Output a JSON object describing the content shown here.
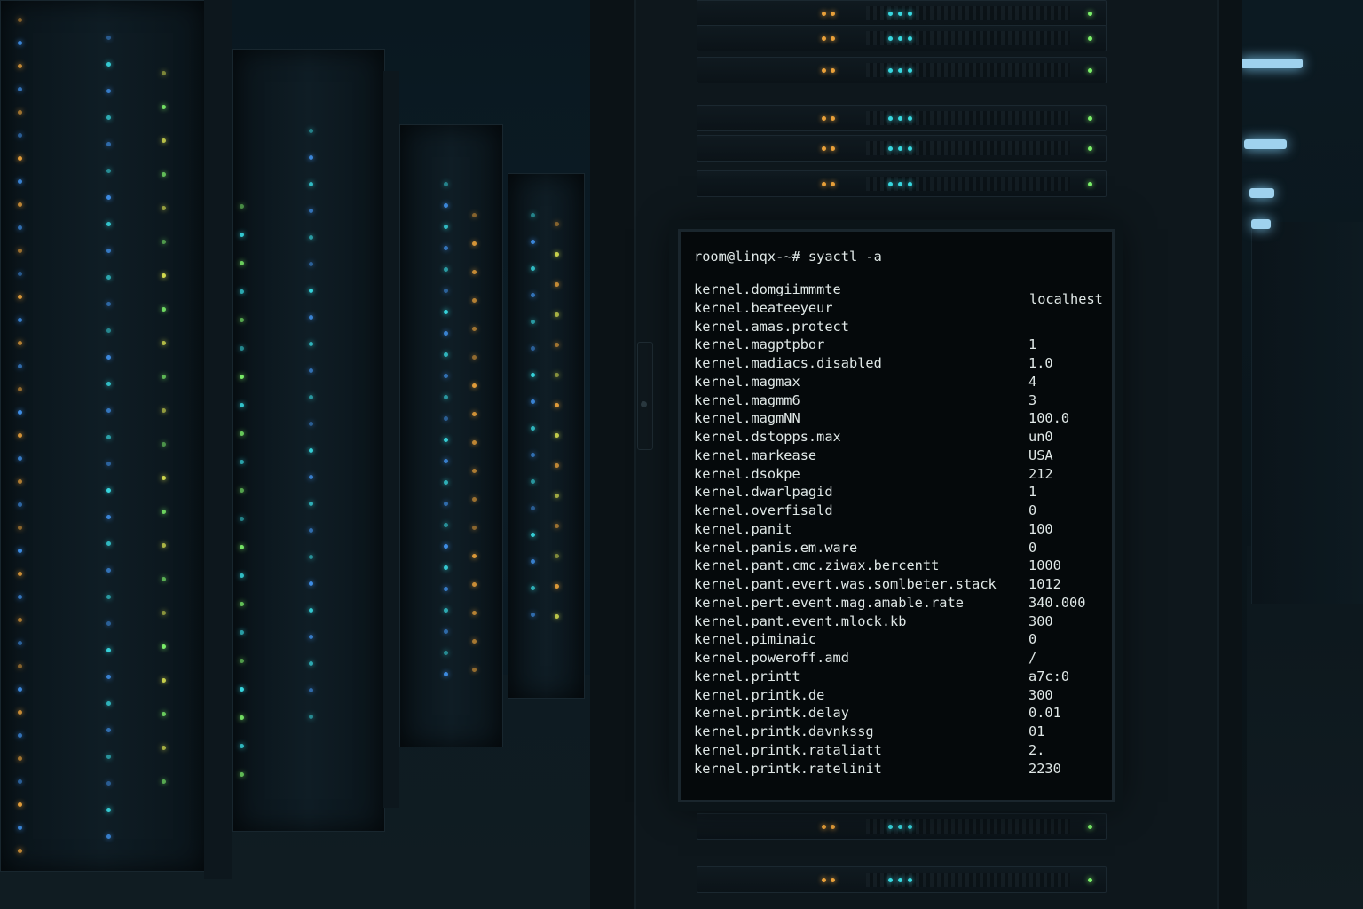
{
  "terminal": {
    "prompt": "room@linqx-~# syactl -a",
    "host": "localhest",
    "rows": [
      {
        "key": "kernel.domgiimmmte",
        "value": ""
      },
      {
        "key": "kernel.beateeyeur",
        "value": ""
      },
      {
        "key": "kernel.amas.protect",
        "value": ""
      },
      {
        "key": "kernel.magptpbor",
        "value": "1"
      },
      {
        "key": "kernel.madiacs.disabled",
        "value": "1.0"
      },
      {
        "key": "kernel.magmax",
        "value": "4"
      },
      {
        "key": "kernel.magmm6",
        "value": "3"
      },
      {
        "key": "kernel.magmNN",
        "value": "100.0"
      },
      {
        "key": "kernel.dstopps.max",
        "value": "un0"
      },
      {
        "key": "kernel.markease",
        "value": "USA"
      },
      {
        "key": "kernel.dsokpe",
        "value": "212"
      },
      {
        "key": "kernel.dwarlpagid",
        "value": "1"
      },
      {
        "key": "kernel.overfisald",
        "value": "0"
      },
      {
        "key": "kernel.panit",
        "value": "100"
      },
      {
        "key": "kernel.panis.em.ware",
        "value": "0"
      },
      {
        "key": "kernel.pant.cmc.ziwax.bercentt",
        "value": "1000"
      },
      {
        "key": "kernel.pant.evert.was.somlbeter.stack",
        "value": "1012"
      },
      {
        "key": "kernel.pert.event.mag.amable.rate",
        "value": "340.000"
      },
      {
        "key": "kernel.pant.event.mlock.kb",
        "value": "300"
      },
      {
        "key": "kernel.piminaic",
        "value": "0"
      },
      {
        "key": "kernel.poweroff.amd",
        "value": "/"
      },
      {
        "key": "kernel.printt",
        "value": "a7c:0"
      },
      {
        "key": "kernel.printk.de",
        "value": "300"
      },
      {
        "key": "kernel.printk.delay",
        "value": "0.01"
      },
      {
        "key": "kernel.printk.davnkssg",
        "value": "01"
      },
      {
        "key": "kernel.printk.rataliatt",
        "value": "2."
      },
      {
        "key": "kernel.printk.ratelinit",
        "value": "2230"
      }
    ]
  },
  "colors": {
    "led_green": "#7cf06a",
    "led_cyan": "#38d8e0",
    "led_blue": "#3f8fe8",
    "led_amber": "#e8a03a",
    "led_yellow": "#d8e050",
    "terminal_text": "#dfe7e6"
  }
}
